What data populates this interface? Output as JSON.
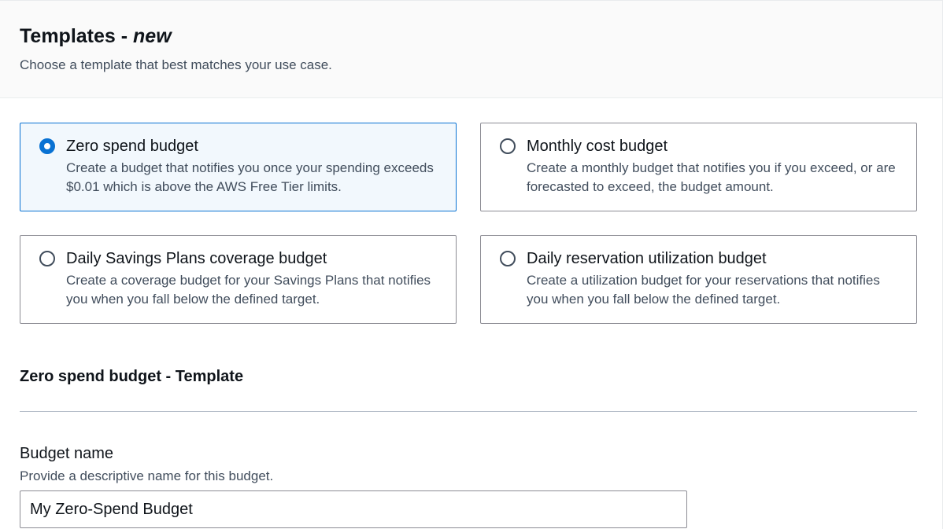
{
  "header": {
    "title": "Templates - ",
    "title_suffix": "new",
    "subtitle": "Choose a template that best matches your use case."
  },
  "templates": [
    {
      "label": "Zero spend budget",
      "description": "Create a budget that notifies you once your spending exceeds $0.01 which is above the AWS Free Tier limits.",
      "selected": true
    },
    {
      "label": "Monthly cost budget",
      "description": "Create a monthly budget that notifies you if you exceed, or are forecasted to exceed, the budget amount.",
      "selected": false
    },
    {
      "label": "Daily Savings Plans coverage budget",
      "description": "Create a coverage budget for your Savings Plans that notifies you when you fall below the defined target.",
      "selected": false
    },
    {
      "label": "Daily reservation utilization budget",
      "description": "Create a utilization budget for your reservations that notifies you when you fall below the defined target.",
      "selected": false
    }
  ],
  "template_section": {
    "title": "Zero spend budget - Template"
  },
  "budget_name": {
    "label": "Budget name",
    "hint": "Provide a descriptive name for this budget.",
    "value": "My Zero-Spend Budget"
  },
  "colors": {
    "accent": "#0972d3",
    "selected_background": "#f2f8fd"
  }
}
